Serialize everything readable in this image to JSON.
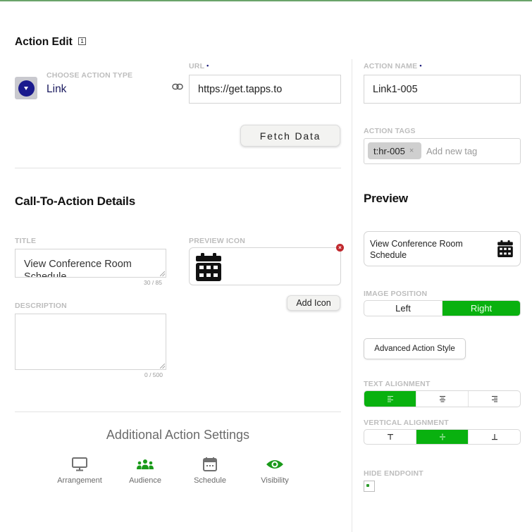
{
  "header": {
    "title": "Action Edit",
    "badge": "1"
  },
  "action_type": {
    "label": "CHOOSE ACTION TYPE",
    "value": "Link"
  },
  "url": {
    "label": "URL",
    "required_mark": "•",
    "value": "https://get.tapps.to"
  },
  "fetch_button": "Fetch Data",
  "action_name": {
    "label": "ACTION NAME",
    "required_mark": "•",
    "value": "Link1-005"
  },
  "action_tags": {
    "label": "ACTION TAGS",
    "tags": [
      "t:hr-005"
    ],
    "remove_glyph": "×",
    "placeholder": "Add new tag"
  },
  "cta": {
    "heading": "Call-To-Action Details",
    "title_label": "TITLE",
    "title_value": "View Conference Room Schedule",
    "title_counter": "30 / 85",
    "preview_icon_label": "PREVIEW ICON",
    "preview_icon": "calendar-icon",
    "remove_icon_glyph": "×",
    "add_icon_button": "Add Icon",
    "description_label": "DESCRIPTION",
    "description_value": "",
    "description_counter": "0 / 500"
  },
  "additional_settings": {
    "heading": "Additional Action Settings",
    "items": [
      {
        "label": "Arrangement",
        "icon": "monitor-icon",
        "color": "#707070"
      },
      {
        "label": "Audience",
        "icon": "users-icon",
        "color": "#1a9a1a"
      },
      {
        "label": "Schedule",
        "icon": "calendar-icon",
        "color": "#707070"
      },
      {
        "label": "Visibility",
        "icon": "eye-icon",
        "color": "#1a9a1a"
      }
    ]
  },
  "preview": {
    "heading": "Preview",
    "card_text": "View Conference Room Schedule",
    "card_icon": "calendar-icon"
  },
  "image_position": {
    "label": "IMAGE POSITION",
    "options": [
      "Left",
      "Right"
    ],
    "selected": "Right"
  },
  "advanced_style_button": "Advanced Action Style",
  "text_alignment": {
    "label": "TEXT ALIGNMENT",
    "options": [
      "align-left-icon",
      "align-center-icon",
      "align-right-icon"
    ],
    "selected": "align-left-icon"
  },
  "vertical_alignment": {
    "label": "VERTICAL ALIGNMENT",
    "options": [
      "align-top-icon",
      "align-middle-icon",
      "align-bottom-icon"
    ],
    "selected": "align-middle-icon"
  },
  "hide_endpoint": {
    "label": "HIDE ENDPOINT",
    "checked": false
  },
  "colors": {
    "accent_green": "#09b10f",
    "action_type_blue": "#1a1a8e",
    "remove_red": "#c0282d"
  }
}
